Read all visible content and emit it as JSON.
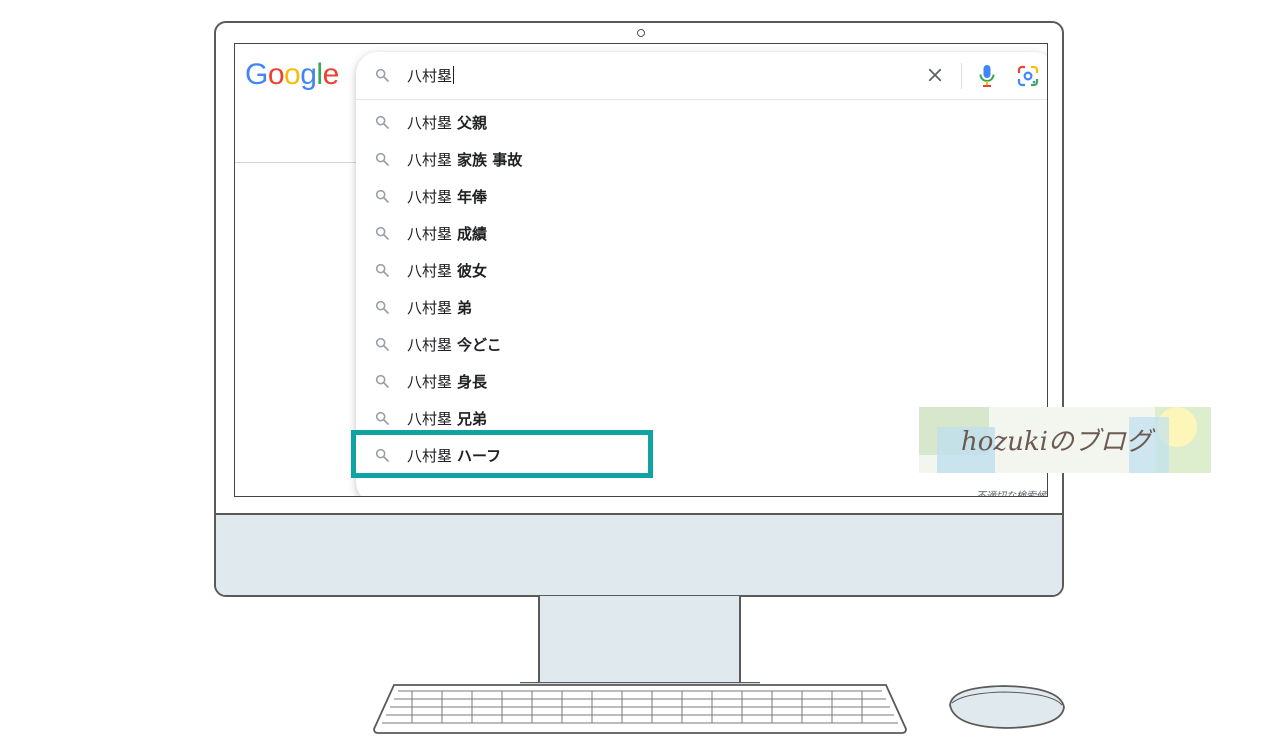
{
  "google": {
    "logo_letters": [
      "G",
      "o",
      "o",
      "g",
      "l",
      "e"
    ],
    "logo_colors": [
      "#4285F4",
      "#EA4335",
      "#FBBC05",
      "#4285F4",
      "#34A853",
      "#EA4335"
    ]
  },
  "search": {
    "query": "八村塁",
    "clear_icon": "close-icon",
    "mic_icon": "microphone-icon",
    "lens_icon": "google-lens-icon"
  },
  "suggestions": [
    {
      "prefix": "八村塁",
      "completion": "父親"
    },
    {
      "prefix": "八村塁",
      "completion": "家族 事故"
    },
    {
      "prefix": "八村塁",
      "completion": "年俸"
    },
    {
      "prefix": "八村塁",
      "completion": "成績"
    },
    {
      "prefix": "八村塁",
      "completion": "彼女"
    },
    {
      "prefix": "八村塁",
      "completion": "弟"
    },
    {
      "prefix": "八村塁",
      "completion": "今どこ"
    },
    {
      "prefix": "八村塁",
      "completion": "身長"
    },
    {
      "prefix": "八村塁",
      "completion": "兄弟"
    },
    {
      "prefix": "八村塁",
      "completion": "ハーフ"
    }
  ],
  "report_link": "不適切な検索候補",
  "highlight": {
    "target": "八村塁 ハーフ",
    "color": "#0fa3a3"
  },
  "watermark": {
    "text": "hozukiのブログ"
  },
  "colors": {
    "device_body": "#dfe9ee",
    "frame_stroke": "#5a5a5a"
  }
}
